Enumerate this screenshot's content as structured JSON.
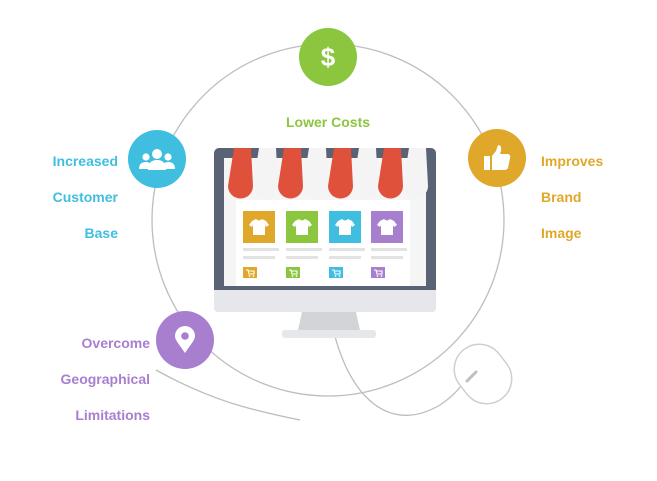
{
  "colors": {
    "green": "#8cc63f",
    "cyan": "#3fbee0",
    "gold": "#e0a82a",
    "purple": "#a87fcf",
    "awning_red": "#e0513b",
    "monitor_frame": "#5a6275",
    "line_gray": "#bdbdbd"
  },
  "benefits": [
    {
      "lines": [
        "Lower Costs"
      ],
      "color": "#8cc63f",
      "icon": "dollar-icon"
    },
    {
      "lines": [
        "Increased",
        "Customer",
        "Base"
      ],
      "color": "#3fbee0",
      "icon": "users-icon"
    },
    {
      "lines": [
        "Improves",
        "Brand",
        "Image"
      ],
      "color": "#e0a82a",
      "icon": "thumbs-up-icon"
    },
    {
      "lines": [
        "Overcome",
        "Geographical",
        "Limitations"
      ],
      "color": "#a87fcf",
      "icon": "location-pin-icon"
    }
  ],
  "store": {
    "products": [
      {
        "color": "#e0a82a",
        "icon": "tshirt-icon"
      },
      {
        "color": "#8cc63f",
        "icon": "tshirt-icon"
      },
      {
        "color": "#3fbee0",
        "icon": "tshirt-icon"
      },
      {
        "color": "#a87fcf",
        "icon": "tshirt-icon"
      }
    ],
    "cart_icon": "cart-icon"
  }
}
